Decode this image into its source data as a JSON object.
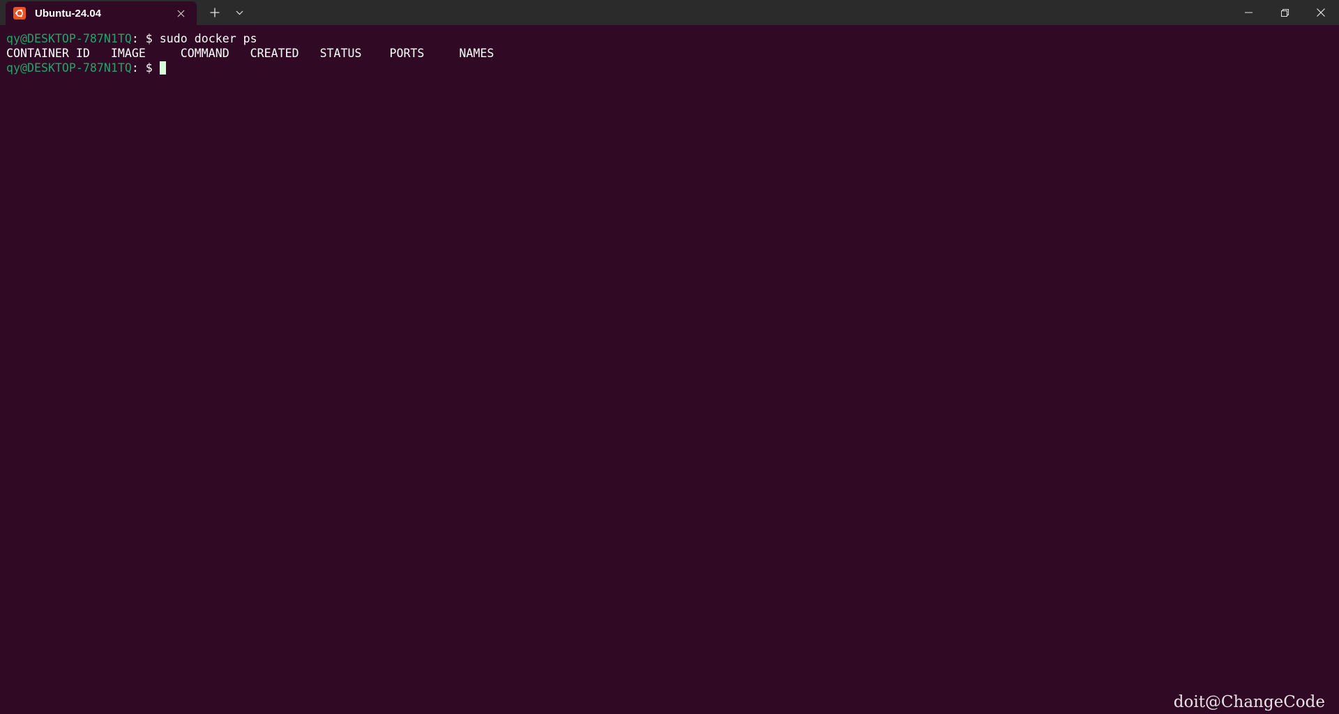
{
  "window": {
    "tab_title": "Ubuntu-24.04",
    "tab_icon": "ubuntu-logo-icon",
    "buttons": {
      "close_tab": "close-icon",
      "new_tab": "plus-icon",
      "tab_dropdown": "chevron-down-icon",
      "minimize": "minimize-icon",
      "restore": "restore-icon",
      "close_window": "close-icon"
    }
  },
  "colors": {
    "background": "#300a24",
    "titlebar": "#2b2b2b",
    "prompt": "#26a269",
    "text": "#ffffff",
    "ubuntu_orange": "#e95420",
    "cursor": "#d8fdd8"
  },
  "terminal": {
    "line1": {
      "prompt_user": "qy@DESKTOP-787N1TQ",
      "prompt_rest": ": $ ",
      "command": "sudo docker ps"
    },
    "output_header": "CONTAINER ID   IMAGE     COMMAND   CREATED   STATUS    PORTS     NAMES",
    "line3": {
      "prompt_user": "qy@DESKTOP-787N1TQ",
      "prompt_rest": ": $ ",
      "command": ""
    }
  },
  "watermark": "doit@ChangeCode"
}
